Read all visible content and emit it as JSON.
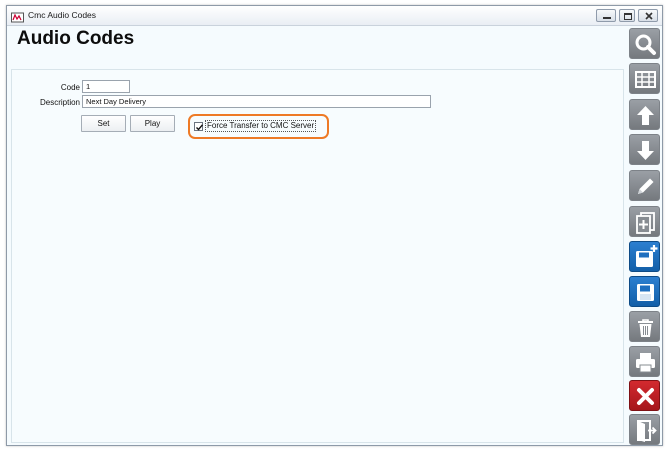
{
  "window": {
    "title": "Cmc Audio Codes"
  },
  "page": {
    "title": "Audio Codes"
  },
  "form": {
    "code_label": "Code",
    "code_value": "1",
    "description_label": "Description",
    "description_value": "Next Day Delivery",
    "set_label": "Set",
    "play_label": "Play",
    "force_transfer_label": "Force Transfer to CMC Server",
    "force_transfer_checked": true
  },
  "toolbar": {
    "buttons": [
      {
        "name": "search",
        "icon": "search-icon"
      },
      {
        "name": "grid",
        "icon": "grid-icon"
      },
      {
        "name": "up",
        "icon": "arrow-up-icon"
      },
      {
        "name": "down",
        "icon": "arrow-down-icon"
      },
      {
        "name": "edit",
        "icon": "pencil-icon"
      },
      {
        "name": "copy",
        "icon": "copy-icon"
      },
      {
        "name": "save-new",
        "icon": "save-new-icon",
        "color": "#1f6fbf"
      },
      {
        "name": "save",
        "icon": "save-icon",
        "color": "#1f6fbf"
      },
      {
        "name": "delete",
        "icon": "trash-icon"
      },
      {
        "name": "print",
        "icon": "printer-icon"
      },
      {
        "name": "cancel",
        "icon": "close-icon",
        "color": "#c0202a"
      },
      {
        "name": "exit",
        "icon": "exit-icon"
      }
    ]
  },
  "colors": {
    "highlight": "#ee7a26",
    "background": "#f5fbfe",
    "toolbar_gray": "#878c92",
    "toolbar_blue": "#1f6fbf",
    "toolbar_red": "#c0202a"
  }
}
